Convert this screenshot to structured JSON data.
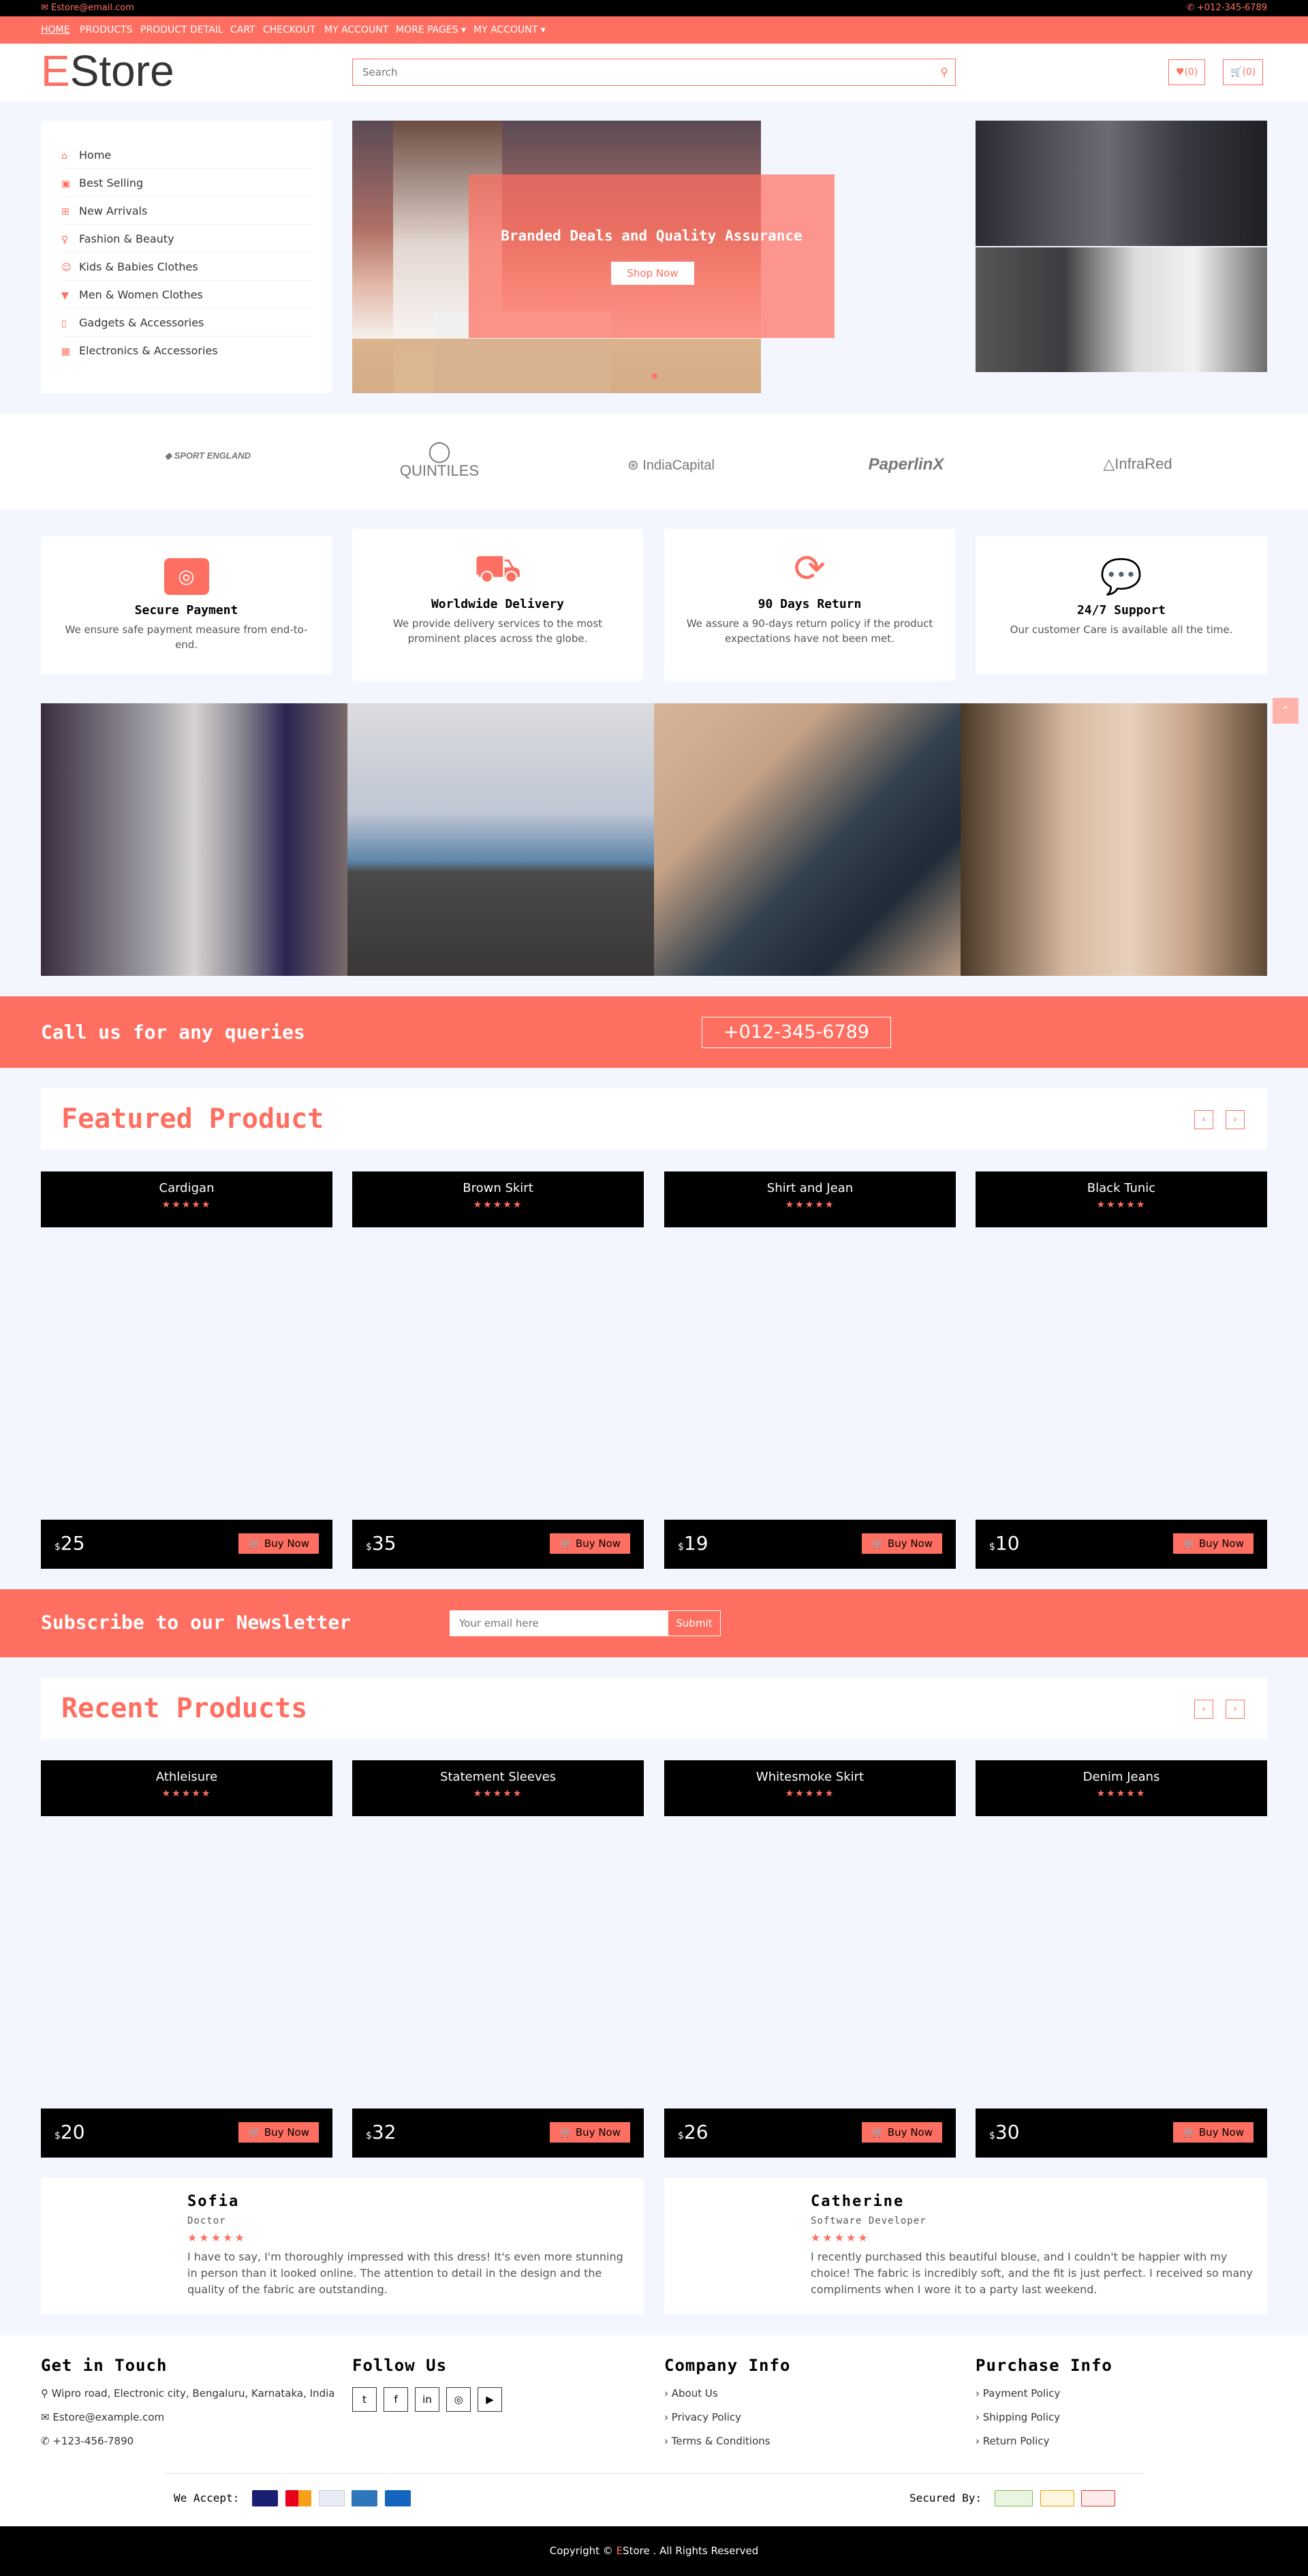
{
  "topbar": {
    "email": "Estore@email.com",
    "phone": "+012-345-6789"
  },
  "nav": {
    "items": [
      "HOME",
      "PRODUCTS",
      "PRODUCT DETAIL",
      "CART",
      "CHECKOUT",
      "MY ACCOUNT",
      "MORE PAGES",
      "MY ACCOUNT"
    ],
    "active_index": 0
  },
  "header": {
    "logo_first": "E",
    "logo_rest": "Store",
    "search_placeholder": "Search",
    "wishlist_label": "(0)",
    "cart_label": "(0)"
  },
  "sidebar": {
    "items": [
      {
        "label": "Home",
        "icon": "home-icon"
      },
      {
        "label": "Best Selling",
        "icon": "shopping-bag-icon"
      },
      {
        "label": "New Arrivals",
        "icon": "plus-square-icon"
      },
      {
        "label": "Fashion & Beauty",
        "icon": "female-icon"
      },
      {
        "label": "Kids & Babies Clothes",
        "icon": "child-icon"
      },
      {
        "label": "Men & Women Clothes",
        "icon": "tshirt-icon"
      },
      {
        "label": "Gadgets & Accessories",
        "icon": "mobile-icon"
      },
      {
        "label": "Electronics & Accessories",
        "icon": "microchip-icon"
      }
    ]
  },
  "hero": {
    "caption": "Branded Deals and Quality Assurance",
    "button": "Shop Now"
  },
  "brands": [
    "SPORT ENGLAND",
    "QUINTILES",
    "IndiaCapital",
    "PaperlinX",
    "InfraRed"
  ],
  "features": [
    {
      "title": "Secure Payment",
      "text": "We ensure safe payment measure from end-to-end.",
      "icon": "credit-card-icon"
    },
    {
      "title": "Worldwide Delivery",
      "text": "We provide delivery services to the most prominent places across the globe.",
      "icon": "truck-icon"
    },
    {
      "title": "90 Days Return",
      "text": "We assure a 90-days return policy if the product expectations have not been met.",
      "icon": "sync-icon"
    },
    {
      "title": "24/7 Support",
      "text": "Our customer Care is available all the time.",
      "icon": "comments-icon"
    }
  ],
  "call_band": {
    "title": "Call us for any queries",
    "phone": "+012-345-6789"
  },
  "featured": {
    "title": "Featured Product",
    "products": [
      {
        "name": "Cardigan",
        "currency": "$",
        "price": "25",
        "button": "Buy Now",
        "rating": 5
      },
      {
        "name": "Brown Skirt",
        "currency": "$",
        "price": "35",
        "button": "Buy Now",
        "rating": 5
      },
      {
        "name": "Shirt and Jean",
        "currency": "$",
        "price": "19",
        "button": "Buy Now",
        "rating": 5
      },
      {
        "name": "Black Tunic",
        "currency": "$",
        "price": "10",
        "button": "Buy Now",
        "rating": 5
      }
    ]
  },
  "newsletter": {
    "title": "Subscribe to our Newsletter",
    "placeholder": "Your email here",
    "button": "Submit"
  },
  "recent": {
    "title": "Recent Products",
    "products": [
      {
        "name": "Athleisure",
        "currency": "$",
        "price": "20",
        "button": "Buy Now",
        "rating": 5
      },
      {
        "name": "Statement Sleeves",
        "currency": "$",
        "price": "32",
        "button": "Buy Now",
        "rating": 5
      },
      {
        "name": "Whitesmoke Skirt",
        "currency": "$",
        "price": "26",
        "button": "Buy Now",
        "rating": 5
      },
      {
        "name": "Denim Jeans",
        "currency": "$",
        "price": "30",
        "button": "Buy Now",
        "rating": 5
      }
    ]
  },
  "reviews": [
    {
      "name": "Sofia",
      "role": "Doctor",
      "rating": 5,
      "text": "I have to say, I'm thoroughly impressed with this dress! It's even more stunning in person than it looked online. The attention to detail in the design and the quality of the fabric are outstanding."
    },
    {
      "name": "Catherine",
      "role": "Software Developer",
      "rating": 5,
      "text": "I recently purchased this beautiful blouse, and I couldn't be happier with my choice! The fabric is incredibly soft, and the fit is just perfect. I received so many compliments when I wore it to a party last weekend."
    }
  ],
  "footer": {
    "contact": {
      "title": "Get in Touch",
      "address": "Wipro road, Electronic city, Bengaluru, Karnataka, India",
      "email": "Estore@example.com",
      "phone": "+123-456-7890"
    },
    "follow": {
      "title": "Follow Us",
      "icons": [
        "twitter-icon",
        "facebook-icon",
        "linkedin-icon",
        "instagram-icon",
        "youtube-icon"
      ]
    },
    "company": {
      "title": "Company Info",
      "links": [
        "About Us",
        "Privacy Policy",
        "Terms & Conditions"
      ]
    },
    "purchase": {
      "title": "Purchase Info",
      "links": [
        "Payment Policy",
        "Shipping Policy",
        "Return Policy"
      ]
    },
    "accept_label": "We Accept:",
    "secured_label": "Secured By:"
  },
  "copyright": {
    "prefix": "Copyright ©",
    "brand": "E",
    "suffix": "Store . All Rights Reserved"
  },
  "colors": {
    "accent": "#ff6f61",
    "dark": "#000000",
    "bg": "#f3f6ff"
  }
}
